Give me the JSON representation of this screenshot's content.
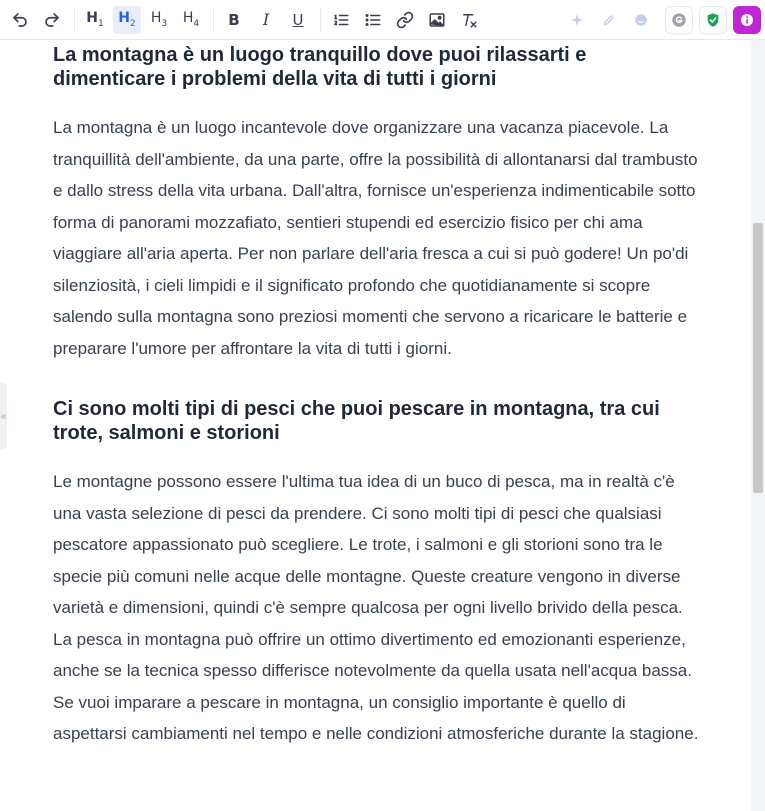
{
  "toolbar": {
    "h1": {
      "letter": "H",
      "num": "1"
    },
    "h2": {
      "letter": "H",
      "num": "2"
    },
    "h3": {
      "letter": "H",
      "num": "3"
    },
    "h4": {
      "letter": "H",
      "num": "4"
    },
    "bold": "B",
    "italic": "I",
    "underline": "U",
    "accent_color": "#2563eb",
    "grammar_badge_color": "#16a34a",
    "info_badge_color": "#c026d3"
  },
  "side_handle": "«",
  "article": {
    "heading1": "La montagna è un luogo tranquillo dove puoi rilassarti e dimenticare i problemi della vita di tutti i giorni",
    "paragraph1": "La montagna è un luogo incantevole dove organizzare una vacanza piacevole. La tranquillità dell'ambiente, da una parte, offre la possibilità di allontanarsi dal trambusto e dallo stress della vita urbana. Dall'altra, fornisce un'esperienza indimenticabile sotto forma di panorami mozzafiato, sentieri stupendi ed esercizio fisico per chi ama viaggiare all'aria aperta. Per non parlare dell'aria fresca a cui si può godere! Un po'di silenziosità, i cieli limpidi e il significato profondo che quotidianamente si scopre salendo sulla montagna sono preziosi momenti che servono a ricaricare le batterie e preparare l'umore per affrontare la vita di tutti i giorni.",
    "heading2": "Ci sono molti tipi di pesci che puoi pescare in montagna, tra cui trote, salmoni e storioni",
    "paragraph2": "Le montagne possono essere l'ultima tua idea di un buco di pesca, ma in realtà c'è una vasta selezione di pesci da prendere. Ci sono molti tipi di pesci che qualsiasi pescatore appassionato può scegliere. Le trote, i salmoni e gli storioni sono tra le specie più comuni nelle acque delle montagne. Queste creature vengono in diverse varietà e dimensioni, quindi c'è sempre qualcosa per ogni livello brivido della pesca. La pesca in montagna può offrire un ottimo divertimento ed emozionanti esperienze, anche se la tecnica spesso differisce notevolmente da quella usata nell'acqua bassa. Se vuoi imparare a pescare in montagna, un consiglio importante è quello di aspettarsi cambiamenti nel tempo e nelle condizioni atmosferiche durante la stagione."
  }
}
